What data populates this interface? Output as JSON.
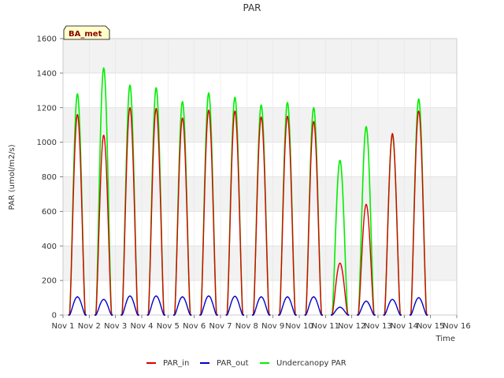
{
  "chart_data": {
    "type": "line",
    "title": "PAR",
    "xlabel": "Time",
    "ylabel": "PAR (umol/m2/s)",
    "badge": "BA_met",
    "xlim": [
      0,
      15
    ],
    "ylim": [
      0,
      1600
    ],
    "x_ticks": [
      0,
      1,
      2,
      3,
      4,
      5,
      6,
      7,
      8,
      9,
      10,
      11,
      12,
      13,
      14,
      15
    ],
    "x_tick_labels": [
      "Nov 1",
      "Nov 2",
      "Nov 3",
      "Nov 4",
      "Nov 5",
      "Nov 6",
      "Nov 7",
      "Nov 8",
      "Nov 9",
      "Nov 10",
      "Nov 11",
      "Nov 12",
      "Nov 13",
      "Nov 14",
      "Nov 15",
      "Nov 16"
    ],
    "y_ticks": [
      0,
      200,
      400,
      600,
      800,
      1000,
      1200,
      1400,
      1600
    ],
    "y_tick_labels": [
      "0",
      "200",
      "400",
      "600",
      "800",
      "1000",
      "1200",
      "1400",
      "1600"
    ],
    "grid": true,
    "background_bands": "alternating light gray",
    "legend_position": "bottom",
    "x_description": "days after Nov 1 (daily peak near midday)",
    "series": [
      {
        "name": "PAR_in",
        "color": "#dd0000",
        "daily_peaks": [
          {
            "day": 0.55,
            "y": 1160
          },
          {
            "day": 1.55,
            "y": 1040
          },
          {
            "day": 2.55,
            "y": 1200
          },
          {
            "day": 3.55,
            "y": 1195
          },
          {
            "day": 4.55,
            "y": 1140
          },
          {
            "day": 5.55,
            "y": 1185
          },
          {
            "day": 6.55,
            "y": 1180
          },
          {
            "day": 7.55,
            "y": 1145
          },
          {
            "day": 8.55,
            "y": 1150
          },
          {
            "day": 9.55,
            "y": 1120
          },
          {
            "day": 10.55,
            "y": 300
          },
          {
            "day": 11.55,
            "y": 640
          },
          {
            "day": 12.55,
            "y": 1050
          },
          {
            "day": 13.55,
            "y": 1180
          }
        ]
      },
      {
        "name": "PAR_out",
        "color": "#0000cc",
        "daily_peaks": [
          {
            "day": 0.55,
            "y": 105
          },
          {
            "day": 1.55,
            "y": 90
          },
          {
            "day": 2.55,
            "y": 110
          },
          {
            "day": 3.55,
            "y": 110
          },
          {
            "day": 4.55,
            "y": 105
          },
          {
            "day": 5.55,
            "y": 110
          },
          {
            "day": 6.55,
            "y": 108
          },
          {
            "day": 7.55,
            "y": 105
          },
          {
            "day": 8.55,
            "y": 105
          },
          {
            "day": 9.55,
            "y": 105
          },
          {
            "day": 10.55,
            "y": 45
          },
          {
            "day": 11.55,
            "y": 80
          },
          {
            "day": 12.55,
            "y": 90
          },
          {
            "day": 13.55,
            "y": 100
          }
        ]
      },
      {
        "name": "Undercanopy PAR",
        "color": "#00ee00",
        "daily_peaks": [
          {
            "day": 0.55,
            "y": 1280
          },
          {
            "day": 1.55,
            "y": 1430
          },
          {
            "day": 2.55,
            "y": 1330
          },
          {
            "day": 3.55,
            "y": 1315
          },
          {
            "day": 4.55,
            "y": 1235
          },
          {
            "day": 5.55,
            "y": 1285
          },
          {
            "day": 6.55,
            "y": 1260
          },
          {
            "day": 7.55,
            "y": 1215
          },
          {
            "day": 8.55,
            "y": 1230
          },
          {
            "day": 9.55,
            "y": 1200
          },
          {
            "day": 10.55,
            "y": 895
          },
          {
            "day": 11.55,
            "y": 1090
          },
          {
            "day": 12.55,
            "y": 1040
          },
          {
            "day": 13.55,
            "y": 1250
          }
        ]
      }
    ]
  }
}
